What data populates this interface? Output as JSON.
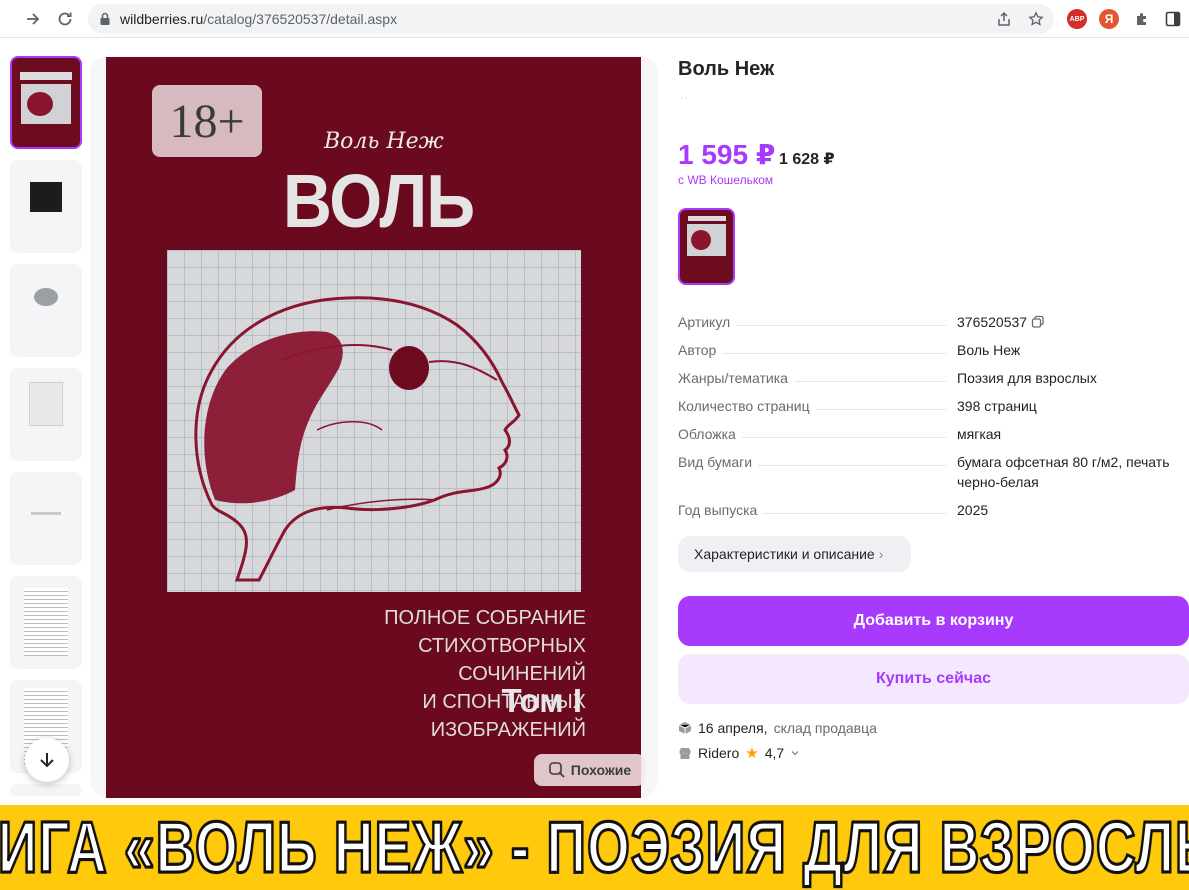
{
  "browser": {
    "url_host": "wildberries.ru",
    "url_path": "/catalog/376520537/detail.aspx",
    "extensions": [
      {
        "name": "adblock",
        "label": "ABP",
        "color": "#d42b2b"
      },
      {
        "name": "yandex",
        "label": "Я",
        "color": "#e4572e"
      }
    ]
  },
  "gallery": {
    "cover": {
      "age_badge": "18+",
      "author_script": "Воль Неж",
      "title": "ВОЛЬ НЕЖ",
      "subtitle_lines": [
        "ПОЛНОЕ СОБРАНИЕ",
        "СТИХОТВОРНЫХ СОЧИНЕНИЙ",
        "И СПОНТАННЫХ ИЗОБРАЖЕНИЙ"
      ],
      "volume": "Том I"
    },
    "similar_label": "Похожие",
    "thumbnail_count": 8
  },
  "product": {
    "title": "Воль Неж",
    "price": "1 595 ₽",
    "old_price": "1 628 ₽",
    "wallet_note": "с WB Кошельком",
    "specs": [
      {
        "label": "Артикул",
        "value": "376520537"
      },
      {
        "label": "Автор",
        "value": "Воль Неж"
      },
      {
        "label": "Жанры/тематика",
        "value": "Поэзия для взрослых"
      },
      {
        "label": "Количество страниц",
        "value": "398 страниц"
      },
      {
        "label": "Обложка",
        "value": "мягкая"
      },
      {
        "label": "Вид бумаги",
        "value": "бумага офсетная 80 г/м2, печать черно-белая"
      },
      {
        "label": "Год выпуска",
        "value": "2025"
      }
    ],
    "characteristics_button": "Характеристики и описание",
    "add_to_cart": "Добавить в корзину",
    "buy_now": "Купить сейчас",
    "delivery_date": "16 апреля,",
    "delivery_source": "склад продавца",
    "seller_name": "Ridero",
    "seller_rating": "4,7"
  },
  "banner": {
    "text": "КНИГА «ВОЛЬ НЕЖ» - ПОЭЗИЯ ДЛЯ ВЗРОСЛЫХ",
    "color": "#ffca0c"
  },
  "colors": {
    "accent": "#a73afd",
    "cover_bg": "#6b0a1e"
  }
}
